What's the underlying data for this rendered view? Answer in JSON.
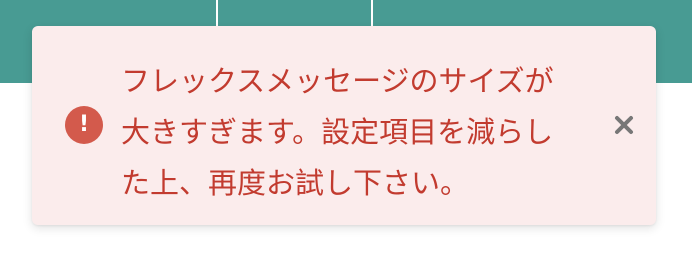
{
  "toast": {
    "type": "error",
    "message": "フレックスメッセージのサイズが\n大きすぎます。設定項目を減らし\nた上、再度お試し下さい。",
    "icon": "alert-circle-icon",
    "close_icon": "close-icon",
    "icon_glyph": "!"
  },
  "colors": {
    "header": "#489b93",
    "toast_background": "#fbecec",
    "message": "#c23b2f",
    "error_icon": "#d35a4c",
    "close_icon": "#777777"
  }
}
